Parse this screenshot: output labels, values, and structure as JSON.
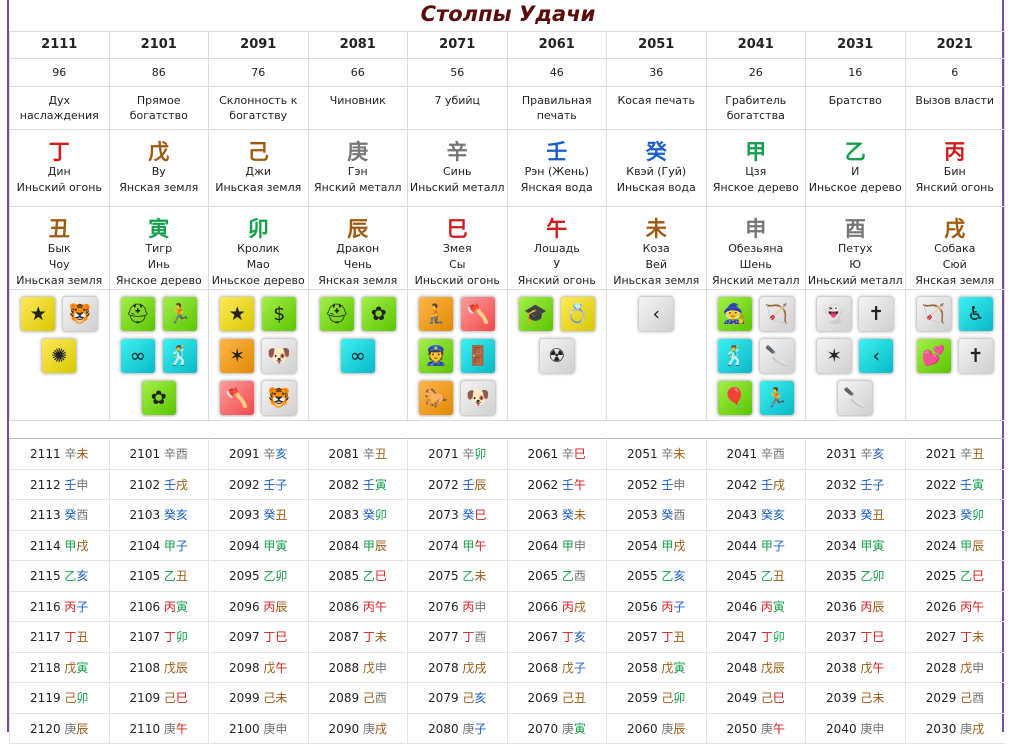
{
  "title": "Столпы Удачи",
  "columns": [
    {
      "year": "2111",
      "age": "96",
      "god": "Дух наслаждения",
      "stem": {
        "char": "丁",
        "name": "Дин",
        "element": "Иньский огонь",
        "color": "fire"
      },
      "branch": {
        "char": "丑",
        "animal": "Бык",
        "name": "Чоу",
        "element": "Иньская земля",
        "color": "earth"
      },
      "icons": [
        {
          "name": "star-icon",
          "glyph": "★",
          "bg": "y"
        },
        {
          "name": "tiger-icon",
          "glyph": "🐯",
          "bg": "w"
        },
        {
          "name": "swirl-icon",
          "glyph": "✺",
          "bg": "y"
        }
      ]
    },
    {
      "year": "2101",
      "age": "86",
      "god": "Прямое богатство",
      "stem": {
        "char": "戊",
        "name": "Ву",
        "element": "Янская земля",
        "color": "earth"
      },
      "branch": {
        "char": "寅",
        "animal": "Тигр",
        "name": "Инь",
        "element": "Янское дерево",
        "color": "wood"
      },
      "icons": [
        {
          "name": "helmet-icon",
          "glyph": "⛑",
          "bg": "g"
        },
        {
          "name": "thief-icon",
          "glyph": "🏃",
          "bg": "g"
        },
        {
          "name": "handcuffs-icon",
          "glyph": "∞",
          "bg": "c"
        },
        {
          "name": "dancer-icon",
          "glyph": "🕺",
          "bg": "c"
        },
        {
          "name": "flower-icon",
          "glyph": "✿",
          "bg": "g"
        }
      ]
    },
    {
      "year": "2091",
      "age": "76",
      "god": "Склонность к богатству",
      "stem": {
        "char": "己",
        "name": "Джи",
        "element": "Иньская земля",
        "color": "earth"
      },
      "branch": {
        "char": "卯",
        "animal": "Кролик",
        "name": "Мао",
        "element": "Иньское дерево",
        "color": "wood"
      },
      "icons": [
        {
          "name": "star-icon",
          "glyph": "★",
          "bg": "y"
        },
        {
          "name": "money-bag-icon",
          "glyph": "$",
          "bg": "g"
        },
        {
          "name": "red-star-icon",
          "glyph": "✶",
          "bg": "o"
        },
        {
          "name": "dog-icon",
          "glyph": "🐶",
          "bg": "w"
        },
        {
          "name": "axe-icon",
          "glyph": "🪓",
          "bg": "r"
        },
        {
          "name": "tiger-icon",
          "glyph": "🐯",
          "bg": "w"
        }
      ]
    },
    {
      "year": "2081",
      "age": "66",
      "god": "Чиновник",
      "stem": {
        "char": "庚",
        "name": "Гэн",
        "element": "Янский металл",
        "color": "metal"
      },
      "branch": {
        "char": "辰",
        "animal": "Дракон",
        "name": "Чень",
        "element": "Янская земля",
        "color": "earth"
      },
      "icons": [
        {
          "name": "helmet-icon",
          "glyph": "⛑",
          "bg": "g"
        },
        {
          "name": "flower-icon",
          "glyph": "✿",
          "bg": "g"
        },
        {
          "name": "handcuffs-icon",
          "glyph": "∞",
          "bg": "c"
        }
      ]
    },
    {
      "year": "2071",
      "age": "56",
      "god": "7 убийц",
      "stem": {
        "char": "辛",
        "name": "Синь",
        "element": "Иньский металл",
        "color": "metal"
      },
      "branch": {
        "char": "巳",
        "animal": "Змея",
        "name": "Сы",
        "element": "Иньский огонь",
        "color": "fire"
      },
      "icons": [
        {
          "name": "sitting-person-icon",
          "glyph": "🧎",
          "bg": "o"
        },
        {
          "name": "axe-icon",
          "glyph": "🪓",
          "bg": "r"
        },
        {
          "name": "officer-icon",
          "glyph": "👮",
          "bg": "g"
        },
        {
          "name": "exit-door-icon",
          "glyph": "🚪",
          "bg": "c"
        },
        {
          "name": "horse-icon",
          "glyph": "🐎",
          "bg": "o"
        },
        {
          "name": "dog-icon",
          "glyph": "🐶",
          "bg": "w"
        }
      ]
    },
    {
      "year": "2061",
      "age": "46",
      "god": "Правильная печать",
      "stem": {
        "char": "壬",
        "name": "Рэн (Жень)",
        "element": "Янская вода",
        "color": "water"
      },
      "branch": {
        "char": "午",
        "animal": "Лошадь",
        "name": "У",
        "element": "Янский огонь",
        "color": "fire"
      },
      "icons": [
        {
          "name": "graduation-cap-icon",
          "glyph": "🎓",
          "bg": "g"
        },
        {
          "name": "rings-icon",
          "glyph": "💍",
          "bg": "y"
        },
        {
          "name": "hazard-icon",
          "glyph": "☢",
          "bg": "w"
        }
      ]
    },
    {
      "year": "2051",
      "age": "36",
      "god": "Косая печать",
      "stem": {
        "char": "癸",
        "name": "Квэй (Гуй)",
        "element": "Иньская вода",
        "color": "water"
      },
      "branch": {
        "char": "未",
        "animal": "Коза",
        "name": "Вей",
        "element": "Иньская земля",
        "color": "earth"
      },
      "icons": [
        {
          "name": "arrow-left-icon",
          "glyph": "‹",
          "bg": "w"
        }
      ]
    },
    {
      "year": "2041",
      "age": "26",
      "god": "Грабитель богатства",
      "stem": {
        "char": "甲",
        "name": "Цзя",
        "element": "Янское дерево",
        "color": "wood"
      },
      "branch": {
        "char": "申",
        "animal": "Обезьяна",
        "name": "Шень",
        "element": "Янский металл",
        "color": "metal"
      },
      "icons": [
        {
          "name": "wizard-icon",
          "glyph": "🧙",
          "bg": "g"
        },
        {
          "name": "bow-arrow-icon",
          "glyph": "🏹",
          "bg": "w"
        },
        {
          "name": "dancer-icon",
          "glyph": "🕺",
          "bg": "c"
        },
        {
          "name": "knife-icon",
          "glyph": "🔪",
          "bg": "w"
        },
        {
          "name": "balloons-icon",
          "glyph": "🎈",
          "bg": "g"
        },
        {
          "name": "thief-icon",
          "glyph": "🏃",
          "bg": "c"
        }
      ]
    },
    {
      "year": "2031",
      "age": "16",
      "god": "Братство",
      "stem": {
        "char": "乙",
        "name": "И",
        "element": "Иньское дерево",
        "color": "wood"
      },
      "branch": {
        "char": "酉",
        "animal": "Петух",
        "name": "Ю",
        "element": "Иньский металл",
        "color": "metal"
      },
      "icons": [
        {
          "name": "ghost-icon",
          "glyph": "👻",
          "bg": "w"
        },
        {
          "name": "grave-icon",
          "glyph": "✝",
          "bg": "w"
        },
        {
          "name": "red-star-icon",
          "glyph": "✶",
          "bg": "w"
        },
        {
          "name": "arrow-left-icon",
          "glyph": "‹",
          "bg": "c"
        },
        {
          "name": "knife-icon",
          "glyph": "🔪",
          "bg": "w"
        }
      ]
    },
    {
      "year": "2021",
      "age": "6",
      "god": "Вызов власти",
      "stem": {
        "char": "丙",
        "name": "Бин",
        "element": "Янский огонь",
        "color": "fire"
      },
      "branch": {
        "char": "戌",
        "animal": "Собака",
        "name": "Сюй",
        "element": "Янская земля",
        "color": "earth"
      },
      "icons": [
        {
          "name": "bow-arrow-icon",
          "glyph": "🏹",
          "bg": "w"
        },
        {
          "name": "wheelchair-icon",
          "glyph": "♿",
          "bg": "c"
        },
        {
          "name": "hearts-icon",
          "glyph": "💕",
          "bg": "g"
        },
        {
          "name": "grave-icon",
          "glyph": "✝",
          "bg": "w"
        }
      ]
    }
  ],
  "years": [
    [
      "2111 辛未",
      "2101 辛酉",
      "2091 辛亥",
      "2081 辛丑",
      "2071 辛卯",
      "2061 辛巳",
      "2051 辛未",
      "2041 辛酉",
      "2031 辛亥",
      "2021 辛丑"
    ],
    [
      "2112 壬申",
      "2102 壬戌",
      "2092 壬子",
      "2082 壬寅",
      "2072 壬辰",
      "2062 壬午",
      "2052 壬申",
      "2042 壬戌",
      "2032 壬子",
      "2022 壬寅"
    ],
    [
      "2113 癸酉",
      "2103 癸亥",
      "2093 癸丑",
      "2083 癸卯",
      "2073 癸巳",
      "2063 癸未",
      "2053 癸酉",
      "2043 癸亥",
      "2033 癸丑",
      "2023 癸卯"
    ],
    [
      "2114 甲戌",
      "2104 甲子",
      "2094 甲寅",
      "2084 甲辰",
      "2074 甲午",
      "2064 甲申",
      "2054 甲戌",
      "2044 甲子",
      "2034 甲寅",
      "2024 甲辰"
    ],
    [
      "2115 乙亥",
      "2105 乙丑",
      "2095 乙卯",
      "2085 乙巳",
      "2075 乙未",
      "2065 乙酉",
      "2055 乙亥",
      "2045 乙丑",
      "2035 乙卯",
      "2025 乙巳"
    ],
    [
      "2116 丙子",
      "2106 丙寅",
      "2096 丙辰",
      "2086 丙午",
      "2076 丙申",
      "2066 丙戌",
      "2056 丙子",
      "2046 丙寅",
      "2036 丙辰",
      "2026 丙午"
    ],
    [
      "2117 丁丑",
      "2107 丁卯",
      "2097 丁巳",
      "2087 丁未",
      "2077 丁酉",
      "2067 丁亥",
      "2057 丁丑",
      "2047 丁卯",
      "2037 丁巳",
      "2027 丁未"
    ],
    [
      "2118 戊寅",
      "2108 戊辰",
      "2098 戊午",
      "2088 戊申",
      "2078 戊戌",
      "2068 戊子",
      "2058 戊寅",
      "2048 戊辰",
      "2038 戊午",
      "2028 戊申"
    ],
    [
      "2119 己卯",
      "2109 己巳",
      "2099 己未",
      "2089 己酉",
      "2079 己亥",
      "2069 己丑",
      "2059 己卯",
      "2049 己巳",
      "2039 己未",
      "2029 己酉"
    ],
    [
      "2120 庚辰",
      "2110 庚午",
      "2100 庚申",
      "2090 庚戌",
      "2080 庚子",
      "2070 庚寅",
      "2060 庚辰",
      "2050 庚午",
      "2040 庚申",
      "2030 庚戌"
    ]
  ],
  "element_colors": {
    "fire": "#d41b1b",
    "earth": "#a05a10",
    "metal": "#777777",
    "water": "#1a5fc8",
    "wood": "#13a04a"
  }
}
